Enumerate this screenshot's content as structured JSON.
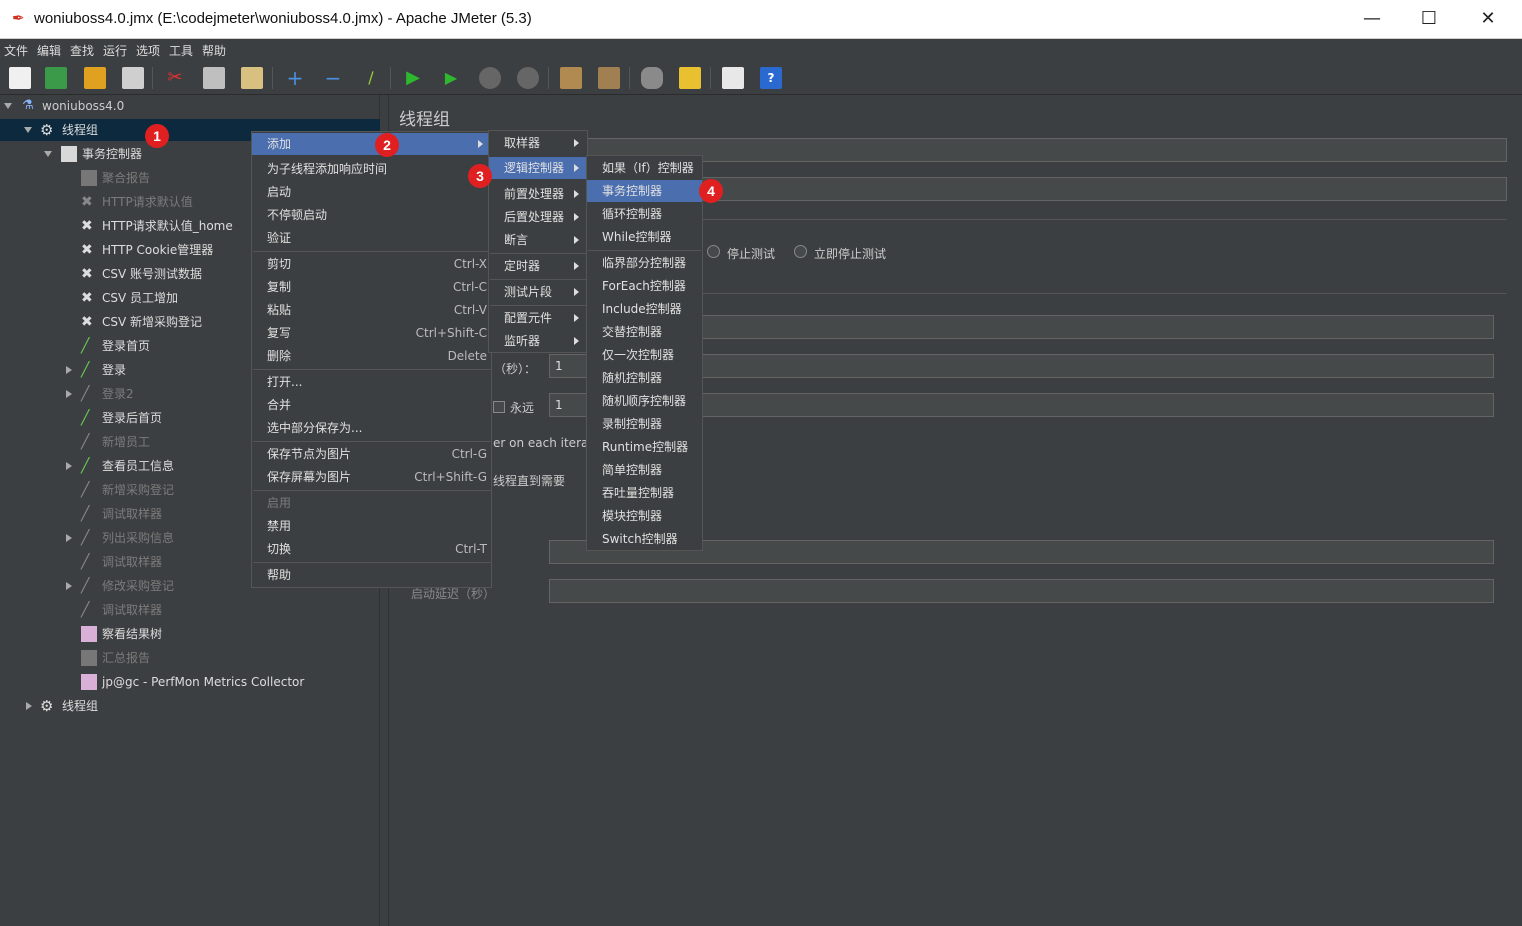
{
  "window": {
    "title": "woniuboss4.0.jmx (E:\\codejmeter\\woniuboss4.0.jmx) - Apache JMeter (5.3)",
    "minimize": "—",
    "maximize": "☐",
    "close": "✕"
  },
  "menubar": [
    "文件",
    "编辑",
    "查找",
    "运行",
    "选项",
    "工具",
    "帮助"
  ],
  "toolbar": [
    "new-icon",
    "templates-icon",
    "open-icon",
    "save-icon",
    "cut-icon",
    "copy-icon",
    "paste-icon",
    "expand-icon",
    "collapse-icon",
    "toggle-icon",
    "start-icon",
    "start-no-pause-icon",
    "stop-icon",
    "shutdown-icon",
    "clear-icon",
    "clear-all-icon",
    "search-icon",
    "reset-search-icon",
    "function-helper-icon",
    "help-icon"
  ],
  "tree": {
    "root": "woniuboss4.0",
    "items": [
      {
        "label": "线程组",
        "level": 1
      },
      {
        "label": "事务控制器",
        "level": 2
      },
      {
        "label": "聚合报告",
        "level": 3
      },
      {
        "label": "HTTP请求默认值",
        "level": 3
      },
      {
        "label": "HTTP请求默认值_home",
        "level": 3
      },
      {
        "label": "HTTP Cookie管理器",
        "level": 3
      },
      {
        "label": "CSV 账号测试数据",
        "level": 3
      },
      {
        "label": "CSV 员工增加",
        "level": 3
      },
      {
        "label": "CSV 新增采购登记",
        "level": 3
      },
      {
        "label": "登录首页",
        "level": 3
      },
      {
        "label": "登录",
        "level": 3
      },
      {
        "label": "登录2",
        "level": 3
      },
      {
        "label": "登录后首页",
        "level": 3
      },
      {
        "label": "新增员工",
        "level": 3
      },
      {
        "label": "查看员工信息",
        "level": 3
      },
      {
        "label": "新增采购登记",
        "level": 3
      },
      {
        "label": "调试取样器",
        "level": 3
      },
      {
        "label": "列出采购信息",
        "level": 3
      },
      {
        "label": "调试取样器",
        "level": 3
      },
      {
        "label": "修改采购登记",
        "level": 3
      },
      {
        "label": "调试取样器",
        "level": 3
      },
      {
        "label": "察看结果树",
        "level": 3
      },
      {
        "label": "汇总报告",
        "level": 3
      },
      {
        "label": "jp@gc - PerfMon Metrics Collector",
        "level": 3
      },
      {
        "label": "线程组",
        "level": 1
      }
    ]
  },
  "badges": [
    "1",
    "2",
    "3",
    "4"
  ],
  "panel": {
    "title": "线程组",
    "stop_test": "停止测试",
    "stop_test_now": "立即停止测试",
    "ramp_up_suffix": "（秒）：",
    "ramp_up_value": "1",
    "forever": "永远",
    "loop_value": "1",
    "same_user_fragment": "er on each iteratio",
    "delay_fragment": "线程直到需要",
    "startup_delay": "启动延迟（秒）"
  },
  "context_menu": {
    "items": [
      {
        "label": "添加",
        "shortcut": ""
      },
      {
        "label": "为子线程添加响应时间",
        "shortcut": ""
      },
      {
        "label": "启动",
        "shortcut": ""
      },
      {
        "label": "不停顿启动",
        "shortcut": ""
      },
      {
        "label": "验证",
        "shortcut": ""
      },
      {
        "label": "剪切",
        "shortcut": "Ctrl-X"
      },
      {
        "label": "复制",
        "shortcut": "Ctrl-C"
      },
      {
        "label": "粘贴",
        "shortcut": "Ctrl-V"
      },
      {
        "label": "复写",
        "shortcut": "Ctrl+Shift-C"
      },
      {
        "label": "删除",
        "shortcut": "Delete"
      },
      {
        "label": "打开...",
        "shortcut": ""
      },
      {
        "label": "合并",
        "shortcut": ""
      },
      {
        "label": "选中部分保存为...",
        "shortcut": ""
      },
      {
        "label": "保存节点为图片",
        "shortcut": "Ctrl-G"
      },
      {
        "label": "保存屏幕为图片",
        "shortcut": "Ctrl+Shift-G"
      },
      {
        "label": "启用",
        "shortcut": ""
      },
      {
        "label": "禁用",
        "shortcut": ""
      },
      {
        "label": "切换",
        "shortcut": "Ctrl-T"
      },
      {
        "label": "帮助",
        "shortcut": ""
      }
    ]
  },
  "add_menu": [
    "取样器",
    "逻辑控制器",
    "前置处理器",
    "后置处理器",
    "断言",
    "定时器",
    "测试片段",
    "配置元件",
    "监听器"
  ],
  "logic_menu": [
    "如果（If）控制器",
    "事务控制器",
    "循环控制器",
    "While控制器",
    "临界部分控制器",
    "ForEach控制器",
    "Include控制器",
    "交替控制器",
    "仅一次控制器",
    "随机控制器",
    "随机顺序控制器",
    "录制控制器",
    "Runtime控制器",
    "简单控制器",
    "吞吐量控制器",
    "模块控制器",
    "Switch控制器"
  ]
}
